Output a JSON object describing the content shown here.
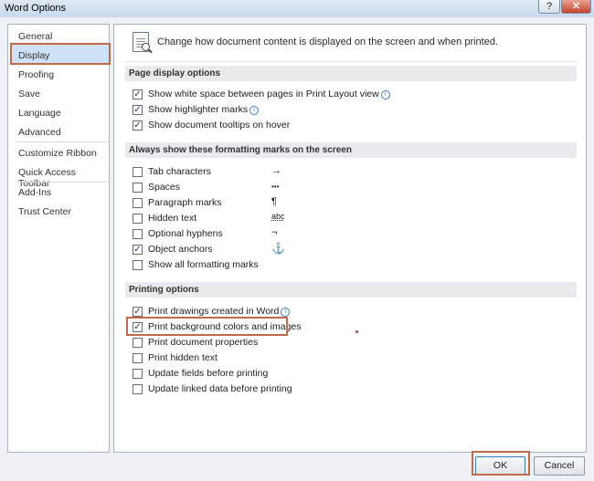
{
  "window": {
    "title": "Word Options",
    "help_label": "?",
    "close_label": "✕"
  },
  "sidebar": {
    "items": [
      {
        "label": "General",
        "selected": false
      },
      {
        "label": "Display",
        "selected": true
      },
      {
        "label": "Proofing",
        "selected": false
      },
      {
        "label": "Save",
        "selected": false
      },
      {
        "label": "Language",
        "selected": false
      },
      {
        "label": "Advanced",
        "selected": false
      },
      {
        "label": "Customize Ribbon",
        "selected": false
      },
      {
        "label": "Quick Access Toolbar",
        "selected": false
      },
      {
        "label": "Add-Ins",
        "selected": false
      },
      {
        "label": "Trust Center",
        "selected": false
      }
    ]
  },
  "header": {
    "text": "Change how document content is displayed on the screen and when printed.",
    "icon": "display-document-icon"
  },
  "sections": {
    "page_display": {
      "title": "Page display options",
      "options": [
        {
          "label": "Show white space between pages in Print Layout view",
          "checked": true,
          "info": true
        },
        {
          "label": "Show highlighter marks",
          "checked": true,
          "info": true
        },
        {
          "label": "Show document tooltips on hover",
          "checked": true,
          "info": false
        }
      ]
    },
    "formatting_marks": {
      "title": "Always show these formatting marks on the screen",
      "options": [
        {
          "label": "Tab characters",
          "checked": false,
          "glyph": "→"
        },
        {
          "label": "Spaces",
          "checked": false,
          "glyph": "•••"
        },
        {
          "label": "Paragraph marks",
          "checked": false,
          "glyph": "¶"
        },
        {
          "label": "Hidden text",
          "checked": false,
          "glyph": "abc"
        },
        {
          "label": "Optional hyphens",
          "checked": false,
          "glyph": "¬"
        },
        {
          "label": "Object anchors",
          "checked": true,
          "glyph": "⚓"
        },
        {
          "label": "Show all formatting marks",
          "checked": false,
          "glyph": ""
        }
      ]
    },
    "printing": {
      "title": "Printing options",
      "options": [
        {
          "label": "Print drawings created in Word",
          "checked": true,
          "info": true
        },
        {
          "label": "Print background colors and images",
          "checked": true,
          "info": false
        },
        {
          "label": "Print document properties",
          "checked": false,
          "info": false
        },
        {
          "label": "Print hidden text",
          "checked": false,
          "info": false
        },
        {
          "label": "Update fields before printing",
          "checked": false,
          "info": false
        },
        {
          "label": "Update linked data before printing",
          "checked": false,
          "info": false
        }
      ]
    }
  },
  "footer": {
    "ok_label": "OK",
    "cancel_label": "Cancel"
  },
  "colors": {
    "highlight_box": "#c0694b",
    "selected_nav": "#cde1f7"
  }
}
